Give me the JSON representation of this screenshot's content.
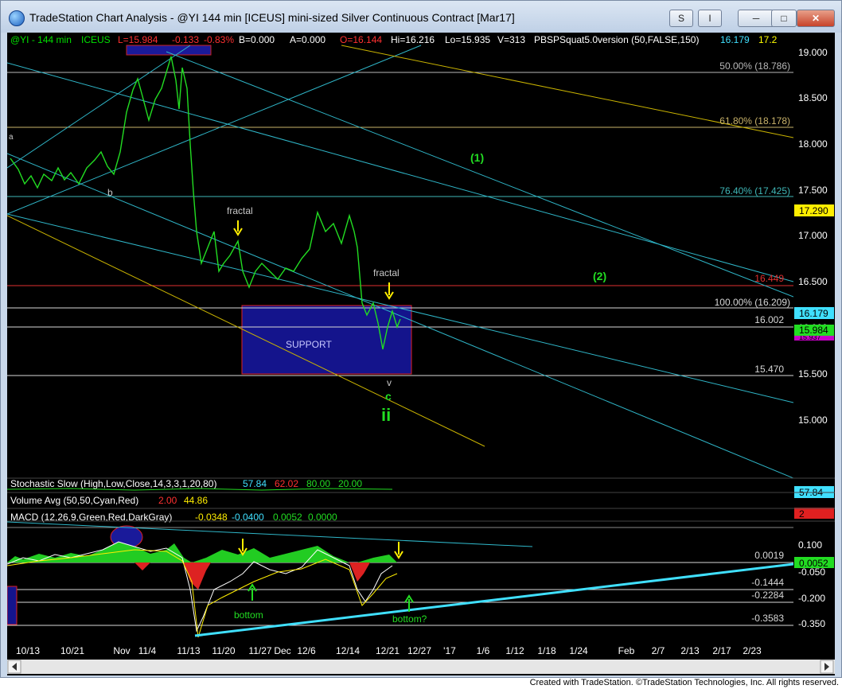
{
  "window": {
    "title": "TradeStation Chart Analysis - @YI 144 min [ICEUS] mini-sized Silver Continuous Contract [Mar17]",
    "btn_s": "S",
    "btn_i": "I"
  },
  "status": {
    "symbol": "@YI - 144 min",
    "exchange": "ICEUS",
    "last": "L=15.984",
    "change": "-0.133",
    "pct": "-0.83%",
    "bid": "B=0.000",
    "ask": "A=0.000",
    "open": "O=16.144",
    "high": "Hi=16.216",
    "low": "Lo=15.935",
    "volume": "V=313",
    "indicator": "PBSPSquat5.0version (50,FALSE,150)",
    "ind_val1": "16.179",
    "ind_val2": "17.2"
  },
  "price_axis": [
    "19.000",
    "18.500",
    "18.000",
    "17.500",
    "17.000",
    "16.500",
    "16.000",
    "15.500",
    "15.000"
  ],
  "price_tags": {
    "tag1": "17.290",
    "tag2": "16.179",
    "tag3": "15.984",
    "tag4": "15.937"
  },
  "levels": {
    "fib50": "50.00% (18.786)",
    "fib618": "61.80% (18.178)",
    "fib764": "76.40% (17.425)",
    "red": "16.449",
    "fib100": "100.00% (16.209)",
    "l16002": "16.002",
    "l15470": "15.470"
  },
  "annotations": {
    "wave1": "(1)",
    "wave2": "(2)",
    "fractal1": "fractal",
    "fractal2": "fractal",
    "support": "SUPPORT",
    "b": "b",
    "a": "a",
    "v": "v",
    "c": "c",
    "ii": "ii",
    "bottom1": "bottom",
    "bottom2": "bottom?"
  },
  "stochastic": {
    "label": "Stochastic Slow (High,Low,Close,14,3,3,1,20,80)",
    "v1": "57.84",
    "v2": "62.02",
    "v3": "80.00",
    "v4": "20.00",
    "tag": "57.84"
  },
  "volume": {
    "label": "Volume Avg (50,50,Cyan,Red)",
    "v1": "2.00",
    "v2": "44.86",
    "tag": "2"
  },
  "macd": {
    "label": "MACD (12,26,9,Green,Red,DarkGray)",
    "v1": "-0.0348",
    "v2": "-0.0400",
    "v3": "0.0052",
    "v4": "0.0000",
    "axis": [
      "0.100",
      "-0.050",
      "-0.200",
      "-0.350"
    ],
    "levels": [
      "0.0019",
      "-0.1444",
      "-0.2284",
      "-0.3583"
    ],
    "tag": "0.0052"
  },
  "time_axis": [
    "10/13",
    "10/21",
    "Nov",
    "11/4",
    "11/13",
    "11/20",
    "11/27",
    "Dec",
    "12/6",
    "12/14",
    "12/21",
    "12/27",
    "'17",
    "1/6",
    "1/12",
    "1/18",
    "1/24",
    "Feb",
    "2/7",
    "2/13",
    "2/17",
    "2/23"
  ],
  "footer": "Created with TradeStation. ©TradeStation Technologies, Inc. All rights reserved."
}
